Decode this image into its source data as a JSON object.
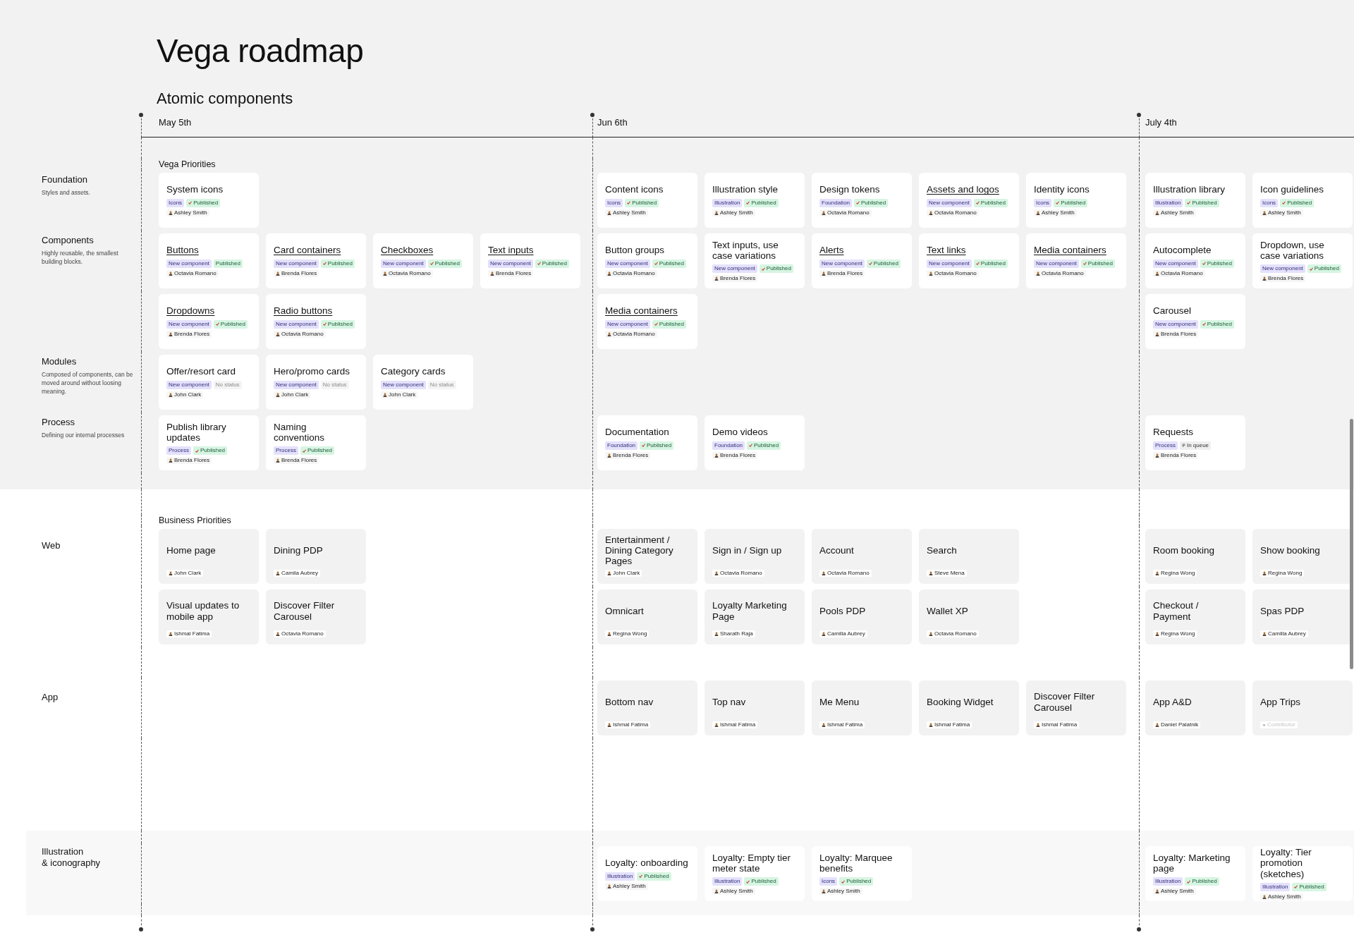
{
  "title": "Vega roadmap",
  "subtitle": "Atomic components",
  "dates": [
    "May 5th",
    "Jun 6th",
    "July 4th"
  ],
  "sections": [
    {
      "kind": "vega",
      "title": "Vega Priorities",
      "groups": [
        {
          "label": "Foundation",
          "description": "Styles and assets.",
          "rows": [
            {
              "a": [
                {
                  "title": "System icons",
                  "link": false,
                  "category": "Icons",
                  "status": {
                    "text": "Published",
                    "kind": "published",
                    "check": true
                  },
                  "owner": {
                    "name": "Ashley Smith",
                    "placeholder": false
                  }
                }
              ],
              "b": [
                {
                  "title": "Content icons",
                  "link": false,
                  "category": "Icons",
                  "status": {
                    "text": "Published",
                    "kind": "published",
                    "check": true
                  },
                  "owner": {
                    "name": "Ashley Smith",
                    "placeholder": false
                  }
                },
                {
                  "title": "Illustration style",
                  "link": false,
                  "category": "Illustration",
                  "status": {
                    "text": "Published",
                    "kind": "published",
                    "check": true
                  },
                  "owner": {
                    "name": "Ashley Smith",
                    "placeholder": false
                  }
                },
                {
                  "title": "Design tokens",
                  "link": false,
                  "category": "Foundation",
                  "status": {
                    "text": "Published",
                    "kind": "published",
                    "check": true
                  },
                  "owner": {
                    "name": "Octavia Romano",
                    "placeholder": false
                  }
                },
                {
                  "title": "Assets and logos",
                  "link": true,
                  "category": "New component",
                  "status": {
                    "text": "Published",
                    "kind": "published",
                    "check": true
                  },
                  "owner": {
                    "name": "Octavia Romano",
                    "placeholder": false
                  }
                },
                {
                  "title": "Identity icons",
                  "link": false,
                  "category": "Icons",
                  "status": {
                    "text": "Published",
                    "kind": "published",
                    "check": true
                  },
                  "owner": {
                    "name": "Ashley Smith",
                    "placeholder": false
                  }
                }
              ],
              "c": [
                {
                  "title": "Illustration library",
                  "link": false,
                  "category": "Illustration",
                  "status": {
                    "text": "Published",
                    "kind": "published",
                    "check": true
                  },
                  "owner": {
                    "name": "Ashley Smith",
                    "placeholder": false
                  }
                },
                {
                  "title": "Icon guidelines",
                  "link": false,
                  "category": "Icons",
                  "status": {
                    "text": "Published",
                    "kind": "published",
                    "check": true
                  },
                  "owner": {
                    "name": "Ashley Smith",
                    "placeholder": false
                  }
                }
              ]
            }
          ]
        },
        {
          "label": "Components",
          "description": "Highly reusable, the smallest building blocks.",
          "rows": [
            {
              "a": [
                {
                  "title": "Buttons",
                  "link": true,
                  "category": "New component",
                  "status": {
                    "text": "Published",
                    "kind": "published",
                    "check": false
                  },
                  "owner": {
                    "name": "Octavia Romano",
                    "placeholder": false
                  }
                },
                {
                  "title": "Card containers",
                  "link": true,
                  "category": "New component",
                  "status": {
                    "text": "Published",
                    "kind": "published",
                    "check": true
                  },
                  "owner": {
                    "name": "Brenda Flores",
                    "placeholder": false
                  }
                },
                {
                  "title": "Checkboxes",
                  "link": true,
                  "category": "New component",
                  "status": {
                    "text": "Published",
                    "kind": "published",
                    "check": true
                  },
                  "owner": {
                    "name": "Octavia Romano",
                    "placeholder": false
                  }
                },
                {
                  "title": "Text inputs",
                  "link": true,
                  "category": "New component",
                  "status": {
                    "text": "Published",
                    "kind": "published",
                    "check": true
                  },
                  "owner": {
                    "name": "Brenda Flores",
                    "placeholder": false
                  }
                }
              ],
              "b": [
                {
                  "title": "Button groups",
                  "link": false,
                  "category": "New component",
                  "status": {
                    "text": "Published",
                    "kind": "published",
                    "check": true
                  },
                  "owner": {
                    "name": "Octavia Romano",
                    "placeholder": false
                  }
                },
                {
                  "title": "Text inputs, use case variations",
                  "link": false,
                  "category": "New component",
                  "status": {
                    "text": "Published",
                    "kind": "published",
                    "check": true
                  },
                  "owner": {
                    "name": "Brenda Flores",
                    "placeholder": false
                  }
                },
                {
                  "title": "Alerts",
                  "link": true,
                  "category": "New component",
                  "status": {
                    "text": "Published",
                    "kind": "published",
                    "check": true
                  },
                  "owner": {
                    "name": "Brenda Flores",
                    "placeholder": false
                  }
                },
                {
                  "title": "Text links",
                  "link": true,
                  "category": "New component",
                  "status": {
                    "text": "Published",
                    "kind": "published",
                    "check": true
                  },
                  "owner": {
                    "name": "Octavia Romano",
                    "placeholder": false
                  }
                },
                {
                  "title": "Media containers",
                  "link": true,
                  "category": "New component",
                  "status": {
                    "text": "Published",
                    "kind": "published",
                    "check": true
                  },
                  "owner": {
                    "name": "Octavia Romano",
                    "placeholder": false
                  }
                }
              ],
              "c": [
                {
                  "title": "Autocomplete",
                  "link": false,
                  "category": "New component",
                  "status": {
                    "text": "Published",
                    "kind": "published",
                    "check": true
                  },
                  "owner": {
                    "name": "Octavia Romano",
                    "placeholder": false
                  }
                },
                {
                  "title": "Dropdown, use case variations",
                  "link": false,
                  "category": "New component",
                  "status": {
                    "text": "Published",
                    "kind": "published",
                    "check": true
                  },
                  "owner": {
                    "name": "Brenda Flores",
                    "placeholder": false
                  }
                }
              ]
            },
            {
              "a": [
                {
                  "title": "Dropdowns",
                  "link": true,
                  "category": "New component",
                  "status": {
                    "text": "Published",
                    "kind": "published",
                    "check": true
                  },
                  "owner": {
                    "name": "Brenda Flores",
                    "placeholder": false
                  }
                },
                {
                  "title": "Radio buttons",
                  "link": true,
                  "category": "New component",
                  "status": {
                    "text": "Published",
                    "kind": "published",
                    "check": true
                  },
                  "owner": {
                    "name": "Octavia Romano",
                    "placeholder": false
                  }
                }
              ],
              "b": [
                {
                  "title": "Media containers",
                  "link": true,
                  "category": "New component",
                  "status": {
                    "text": "Published",
                    "kind": "published",
                    "check": true
                  },
                  "owner": {
                    "name": "Octavia Romano",
                    "placeholder": false
                  }
                }
              ],
              "c": [
                {
                  "title": "Carousel",
                  "link": false,
                  "category": "New component",
                  "status": {
                    "text": "Published",
                    "kind": "published",
                    "check": true
                  },
                  "owner": {
                    "name": "Brenda Flores",
                    "placeholder": false
                  }
                }
              ]
            }
          ]
        },
        {
          "label": "Modules",
          "description": "Composed of components, can be moved around without loosing meaning.",
          "rows": [
            {
              "a": [
                {
                  "title": "Offer/resort card",
                  "link": false,
                  "category": "New component",
                  "status": {
                    "text": "No status",
                    "kind": "none"
                  },
                  "owner": {
                    "name": "John Clark",
                    "placeholder": false
                  }
                },
                {
                  "title": "Hero/promo cards",
                  "link": false,
                  "category": "New component",
                  "status": {
                    "text": "No status",
                    "kind": "none"
                  },
                  "owner": {
                    "name": "John Clark",
                    "placeholder": false
                  }
                },
                {
                  "title": "Category cards",
                  "link": false,
                  "category": "New component",
                  "status": {
                    "text": "No status",
                    "kind": "none"
                  },
                  "owner": {
                    "name": "John Clark",
                    "placeholder": false
                  }
                }
              ]
            }
          ]
        },
        {
          "label": "Process",
          "description": "Defining our internal processes",
          "rows": [
            {
              "a": [
                {
                  "title": "Publish library updates",
                  "link": false,
                  "category": "Process",
                  "status": {
                    "text": "Published",
                    "kind": "published",
                    "check": true
                  },
                  "owner": {
                    "name": "Brenda Flores",
                    "placeholder": false
                  }
                },
                {
                  "title": "Naming conventions",
                  "link": false,
                  "category": "Process",
                  "status": {
                    "text": "Published",
                    "kind": "published",
                    "check": true
                  },
                  "owner": {
                    "name": "Brenda Flores",
                    "placeholder": false
                  }
                }
              ],
              "b": [
                {
                  "title": "Documentation",
                  "link": false,
                  "category": "Foundation",
                  "status": {
                    "text": "Published",
                    "kind": "published",
                    "check": true
                  },
                  "owner": {
                    "name": "Brenda Flores",
                    "placeholder": false
                  }
                },
                {
                  "title": "Demo videos",
                  "link": false,
                  "category": "Foundation",
                  "status": {
                    "text": "Published",
                    "kind": "published",
                    "check": true
                  },
                  "owner": {
                    "name": "Brenda Flores",
                    "placeholder": false
                  }
                }
              ],
              "c": [
                {
                  "title": "Requests",
                  "link": false,
                  "category": "Process",
                  "status": {
                    "text": "In queue",
                    "kind": "queue"
                  },
                  "owner": {
                    "name": "Brenda Flores",
                    "placeholder": false
                  }
                }
              ]
            }
          ]
        }
      ]
    },
    {
      "kind": "business",
      "title": "Business Priorities",
      "groups": [
        {
          "label": "Web",
          "rows": [
            {
              "a": [
                {
                  "title": "Home page",
                  "link": false,
                  "owner": {
                    "name": "John Clark",
                    "placeholder": false
                  }
                },
                {
                  "title": "Dining PDP",
                  "link": false,
                  "owner": {
                    "name": "Camila Aubrey",
                    "placeholder": false
                  }
                }
              ],
              "b": [
                {
                  "title": "Entertainment / Dining Category Pages",
                  "link": false,
                  "owner": {
                    "name": "John Clark",
                    "placeholder": false
                  }
                },
                {
                  "title": "Sign in / Sign up",
                  "link": false,
                  "owner": {
                    "name": "Octavia Romano",
                    "placeholder": false
                  }
                },
                {
                  "title": "Account",
                  "link": false,
                  "owner": {
                    "name": "Octavia Romano",
                    "placeholder": false
                  }
                },
                {
                  "title": "Search",
                  "link": false,
                  "owner": {
                    "name": "Steve Mena",
                    "placeholder": false
                  }
                }
              ],
              "c": [
                {
                  "title": "Room booking",
                  "link": false,
                  "owner": {
                    "name": "Regina Wong",
                    "placeholder": false
                  }
                },
                {
                  "title": "Show booking",
                  "link": false,
                  "owner": {
                    "name": "Regina Wong",
                    "placeholder": false
                  }
                }
              ]
            },
            {
              "a": [
                {
                  "title": "Visual updates to mobile app",
                  "link": false,
                  "owner": {
                    "name": "Ishmal Fatima",
                    "placeholder": false
                  }
                },
                {
                  "title": "Discover Filter Carousel",
                  "link": false,
                  "owner": {
                    "name": "Octavia Romano",
                    "placeholder": false
                  }
                }
              ],
              "b": [
                {
                  "title": "Omnicart",
                  "link": false,
                  "owner": {
                    "name": "Regina Wong",
                    "placeholder": false
                  }
                },
                {
                  "title": "Loyalty Marketing Page",
                  "link": false,
                  "owner": {
                    "name": "Sharath Raja",
                    "placeholder": false
                  }
                },
                {
                  "title": "Pools PDP",
                  "link": false,
                  "owner": {
                    "name": "Camilla Aubrey",
                    "placeholder": false
                  }
                },
                {
                  "title": "Wallet XP",
                  "link": false,
                  "owner": {
                    "name": "Octavia Romano",
                    "placeholder": false
                  }
                }
              ],
              "c": [
                {
                  "title": "Checkout / Payment",
                  "link": false,
                  "owner": {
                    "name": "Regina Wong",
                    "placeholder": false
                  }
                },
                {
                  "title": "Spas PDP",
                  "link": false,
                  "owner": {
                    "name": "Camilla Aubrey",
                    "placeholder": false
                  }
                }
              ]
            }
          ]
        },
        {
          "label": "App",
          "rows": [
            {
              "b": [
                {
                  "title": "Bottom nav",
                  "link": false,
                  "owner": {
                    "name": "Ishmal Fatima",
                    "placeholder": false
                  }
                },
                {
                  "title": "Top nav",
                  "link": false,
                  "owner": {
                    "name": "Ishmal Fatima",
                    "placeholder": false
                  }
                },
                {
                  "title": "Me Menu",
                  "link": false,
                  "owner": {
                    "name": "Ishmal Fatima",
                    "placeholder": false
                  }
                },
                {
                  "title": "Booking Widget",
                  "link": false,
                  "owner": {
                    "name": "Ishmal Fatima",
                    "placeholder": false
                  }
                },
                {
                  "title": "Discover Filter Carousel",
                  "link": false,
                  "owner": {
                    "name": "Ishmal Fatima",
                    "placeholder": false
                  }
                }
              ],
              "c": [
                {
                  "title": "App A&D",
                  "link": false,
                  "owner": {
                    "name": "Daniel Palatnik",
                    "placeholder": false
                  }
                },
                {
                  "title": "App Trips",
                  "link": false,
                  "owner": {
                    "name": "Contributor",
                    "placeholder": true
                  }
                }
              ]
            }
          ]
        }
      ]
    },
    {
      "kind": "illustration",
      "groups": [
        {
          "label": "Illustration\n& iconography",
          "rows": [
            {
              "b": [
                {
                  "title": "Loyalty: onboarding",
                  "link": false,
                  "category": "Illustration",
                  "status": {
                    "text": "Published",
                    "kind": "published",
                    "check": true
                  },
                  "owner": {
                    "name": "Ashley Smith",
                    "placeholder": false
                  }
                },
                {
                  "title": "Loyalty: Empty tier meter state",
                  "link": false,
                  "category": "Illustration",
                  "status": {
                    "text": "Published",
                    "kind": "published",
                    "check": true
                  },
                  "owner": {
                    "name": "Ashley Smith",
                    "placeholder": false
                  }
                },
                {
                  "title": "Loyalty: Marquee benefits",
                  "link": false,
                  "category": "Icons",
                  "status": {
                    "text": "Published",
                    "kind": "published",
                    "check": true
                  },
                  "owner": {
                    "name": "Ashley Smith",
                    "placeholder": false
                  }
                }
              ],
              "c": [
                {
                  "title": "Loyalty: Marketing page",
                  "link": false,
                  "category": "Illustration",
                  "status": {
                    "text": "Published",
                    "kind": "published",
                    "check": true
                  },
                  "owner": {
                    "name": "Ashley Smith",
                    "placeholder": false
                  }
                },
                {
                  "title": "Loyalty: Tier promotion (sketches)",
                  "link": false,
                  "category": "Illustration",
                  "status": {
                    "text": "Published",
                    "kind": "published",
                    "check": true
                  },
                  "owner": {
                    "name": "Ashley Smith",
                    "placeholder": false
                  }
                }
              ]
            }
          ]
        }
      ]
    }
  ]
}
